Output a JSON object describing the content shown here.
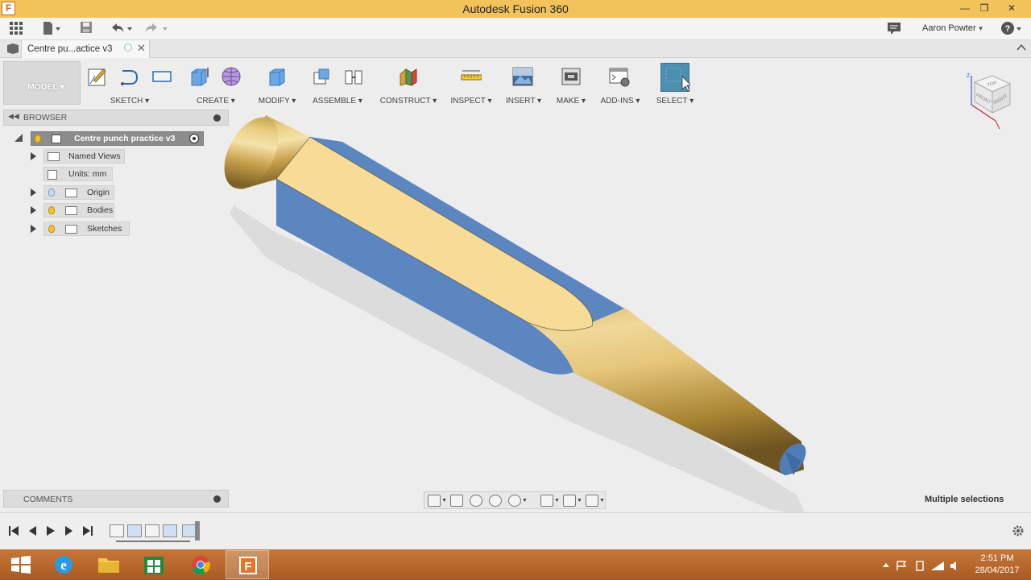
{
  "window": {
    "title": "Autodesk Fusion 360",
    "minimize": "—",
    "restore": "❒",
    "close": "✕"
  },
  "quick_access": {
    "user": "Aaron Powter",
    "help": "?"
  },
  "document_tab": {
    "label": "Centre pu...actice v3",
    "close": "✕"
  },
  "toolbar": {
    "mode": "MODEL",
    "groups": [
      "SKETCH",
      "CREATE",
      "MODIFY",
      "ASSEMBLE",
      "CONSTRUCT",
      "INSPECT",
      "INSERT",
      "MAKE",
      "ADD-INS",
      "SELECT"
    ]
  },
  "browser": {
    "header": "BROWSER",
    "root": "Centre punch practice v3",
    "items": [
      "Named Views",
      "Units: mm",
      "Origin",
      "Bodies",
      "Sketches"
    ]
  },
  "comments": {
    "header": "COMMENTS"
  },
  "viewcube": {
    "top": "TOP",
    "front": "FRONT",
    "right": "RIGHT",
    "axis_z": "Z"
  },
  "status": {
    "selection": "Multiple selections"
  },
  "taskbar": {
    "time": "2:51 PM",
    "date": "28/04/2017"
  },
  "colors": {
    "titlebar": "#f2c35a",
    "body_gold": "#d8b35a",
    "face_yellow": "#f6dc97",
    "face_blue": "#5b86c0",
    "select_accent": "#4d8fae",
    "taskbar": "#b9662b"
  }
}
